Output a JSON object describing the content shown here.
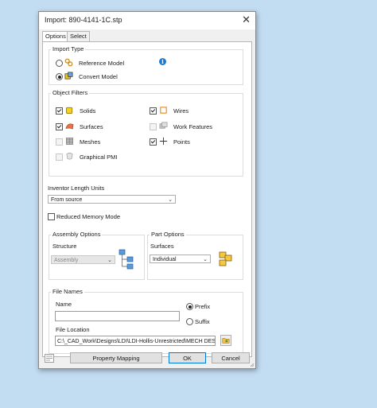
{
  "window": {
    "title": "Import:  890-4141-1C.stp",
    "close_glyph": "✕"
  },
  "tabs": [
    {
      "label": "Options"
    },
    {
      "label": "Select"
    }
  ],
  "import_type": {
    "label": "Import Type",
    "options": [
      {
        "label": "Reference Model",
        "selected": false
      },
      {
        "label": "Convert Model",
        "selected": true
      }
    ]
  },
  "object_filters": {
    "label": "Object Filters",
    "items": [
      {
        "label": "Solids",
        "checked": true,
        "enabled": true
      },
      {
        "label": "Wires",
        "checked": true,
        "enabled": true
      },
      {
        "label": "Surfaces",
        "checked": true,
        "enabled": true
      },
      {
        "label": "Work Features",
        "checked": false,
        "enabled": false
      },
      {
        "label": "Meshes",
        "checked": false,
        "enabled": false
      },
      {
        "label": "Points",
        "checked": true,
        "enabled": true
      },
      {
        "label": "Graphical PMI",
        "checked": false,
        "enabled": false
      }
    ]
  },
  "length_units": {
    "label": "Inventor Length Units",
    "value": "From source"
  },
  "reduced_memory": {
    "label": "Reduced Memory Mode",
    "checked": false
  },
  "assembly_options": {
    "label": "Assembly Options",
    "structure_label": "Structure",
    "structure_value": "Assembly"
  },
  "part_options": {
    "label": "Part Options",
    "surfaces_label": "Surfaces",
    "surfaces_value": "Individual"
  },
  "file_names": {
    "label": "File Names",
    "name_label": "Name",
    "name_value": "",
    "prefix_label": "Prefix",
    "suffix_label": "Suffix",
    "prefix_selected": true,
    "location_label": "File Location",
    "location_value": "C:\\_CAD_Work\\Designs\\LDI\\LDI-Hollis-Unrestricted\\MECH DESK"
  },
  "buttons": {
    "property_mapping": "Property Mapping",
    "ok": "OK",
    "cancel": "Cancel"
  },
  "colors": {
    "accent": "#0078d7",
    "info": "#1e7ad0",
    "desktop": "#c2dcf2"
  }
}
